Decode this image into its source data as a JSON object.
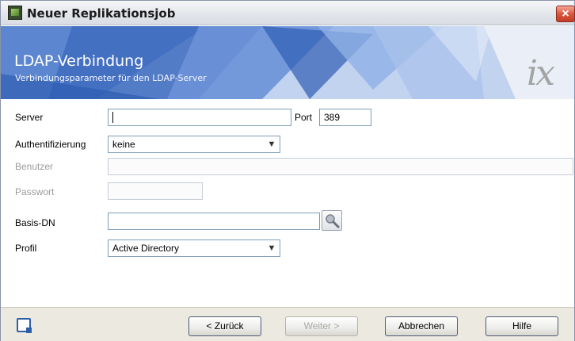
{
  "window": {
    "title": "Neuer Replikationsjob",
    "close_label": "×"
  },
  "banner": {
    "title": "LDAP-Verbindung",
    "subtitle": "Verbindungsparameter für den LDAP-Server",
    "logo_text": "ix"
  },
  "form": {
    "server_label": "Server",
    "server_value": "",
    "port_label": "Port",
    "port_value": "389",
    "auth_label": "Authentifizierung",
    "auth_value": "keine",
    "user_label": "Benutzer",
    "user_value": "",
    "password_label": "Passwort",
    "password_value": "",
    "basedn_label": "Basis-DN",
    "basedn_value": "",
    "profile_label": "Profil",
    "profile_value": "Active Directory"
  },
  "buttons": {
    "back": "< Zurück",
    "next": "Weiter >",
    "cancel": "Abbrechen",
    "help": "Hilfe"
  },
  "icons": {
    "app": "replication-app-icon",
    "search": "search-magnifier-icon",
    "dropdown": "chevron-down-icon",
    "footer": "window-restore-icon"
  }
}
